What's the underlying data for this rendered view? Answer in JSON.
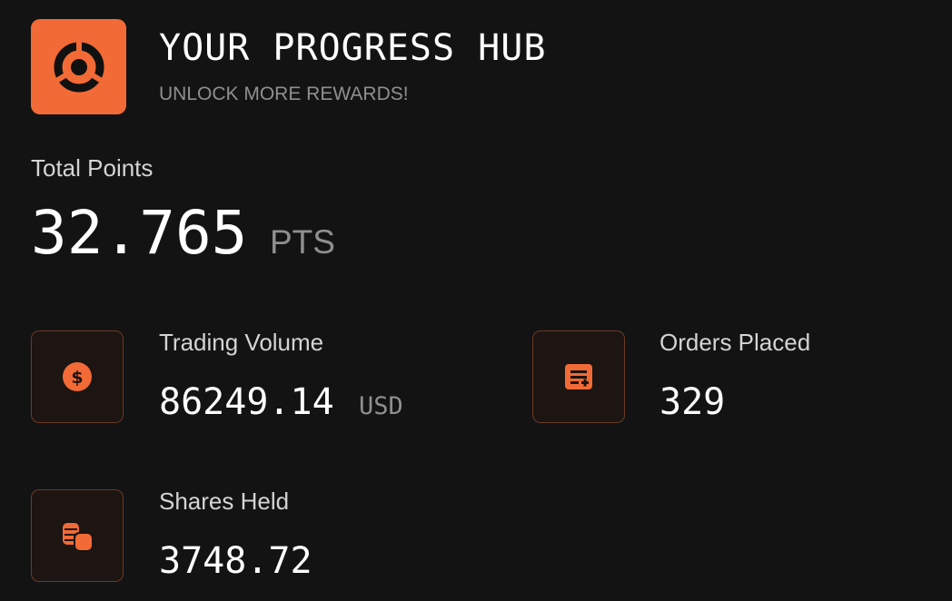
{
  "header": {
    "title": "YOUR PROGRESS HUB",
    "subtitle": "UNLOCK MORE REWARDS!",
    "logo_icon": "segmented-ring-icon"
  },
  "total_points": {
    "label": "Total Points",
    "value": "32.765",
    "unit": "PTS"
  },
  "stats": {
    "trading_volume": {
      "label": "Trading Volume",
      "value": "86249.14",
      "unit": "USD",
      "icon": "dollar-coin-icon"
    },
    "orders_placed": {
      "label": "Orders Placed",
      "value": "329",
      "icon": "order-list-add-icon"
    },
    "shares_held": {
      "label": "Shares Held",
      "value": "3748.72",
      "icon": "coin-stack-icon"
    }
  },
  "colors": {
    "accent": "#f26a36",
    "background": "#131313",
    "muted_text": "#8f8f8f",
    "icon_tile_border": "#6b3a26",
    "icon_tile_bg": "#1c1512"
  }
}
